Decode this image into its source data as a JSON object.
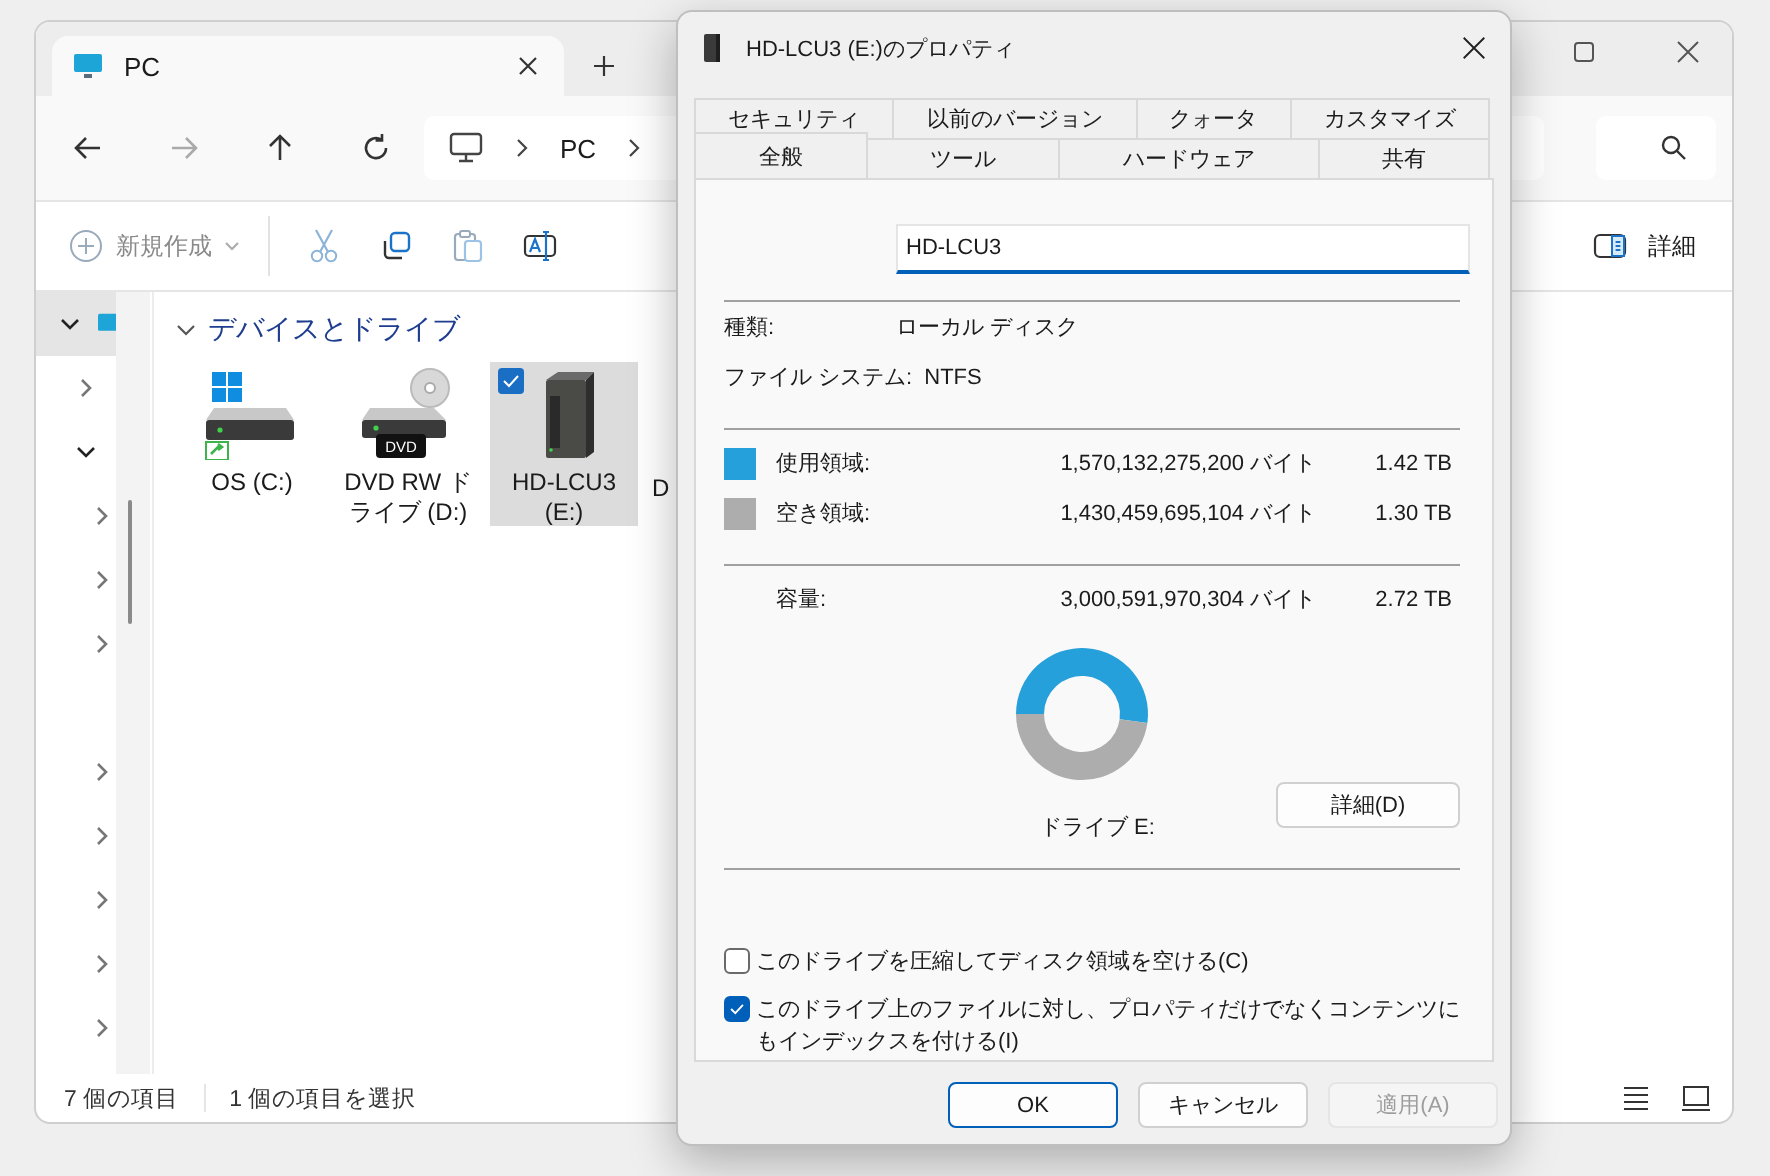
{
  "explorer": {
    "tabs": [
      {
        "title": "PC",
        "selected": true
      }
    ],
    "breadcrumb": [
      "PC"
    ],
    "new_button": "新規作成",
    "details_button": "詳細",
    "nav_tree": [
      {
        "selected": true,
        "expanded": true,
        "expandable": true,
        "children": [
          {
            "selected": false,
            "expanded": false,
            "expandable": true
          },
          {
            "selected": false,
            "expanded": true,
            "expandable": true,
            "children": [
              {
                "selected": false,
                "expanded": false,
                "expandable": true
              },
              {
                "selected": false,
                "expanded": false,
                "expandable": true
              },
              {
                "selected": false,
                "expanded": false,
                "expandable": true
              },
              {
                "selected": false
              },
              {
                "selected": false,
                "expanded": false,
                "expandable": true
              },
              {
                "selected": false,
                "expanded": false,
                "expandable": true
              },
              {
                "selected": false,
                "expanded": false,
                "expandable": true
              },
              {
                "selected": false,
                "expanded": false,
                "expandable": true
              },
              {
                "selected": false,
                "expanded": false,
                "expandable": true
              }
            ]
          }
        ]
      }
    ],
    "group": {
      "title": "デバイスとドライブ",
      "expanded": true
    },
    "drives": [
      {
        "label": "OS (C:)",
        "kind": "system",
        "selected": false
      },
      {
        "label": "DVD RW ドライブ (D:)",
        "kind": "dvd",
        "badge": "DVD",
        "selected": false
      },
      {
        "label": "HD-LCU3 (E:)",
        "kind": "external",
        "selected": true
      },
      {
        "label": "D",
        "kind": "covered",
        "selected": false
      }
    ],
    "status": {
      "count": "7 個の項目",
      "selection": "1 個の項目を選択"
    }
  },
  "dialog": {
    "title": "HD-LCU3 (E:)のプロパティ",
    "tab_rows": [
      [
        {
          "label": "セキュリティ",
          "selected": false
        },
        {
          "label": "以前のバージョン",
          "selected": false
        },
        {
          "label": "クォータ",
          "selected": false
        },
        {
          "label": "カスタマイズ",
          "selected": false
        }
      ],
      [
        {
          "label": "全般",
          "selected": true
        },
        {
          "label": "ツール",
          "selected": false
        },
        {
          "label": "ハードウェア",
          "selected": false
        },
        {
          "label": "共有",
          "selected": false
        }
      ]
    ],
    "name": "HD-LCU3",
    "info": [
      {
        "label": "種類:",
        "value": "ローカル ディスク"
      },
      {
        "label": "ファイル システム:",
        "value": "NTFS"
      }
    ],
    "usage": [
      {
        "label": "使用領域:",
        "bytes": "1,570,132,275,200 バイト",
        "size": "1.42 TB",
        "color": "#26a0da"
      },
      {
        "label": "空き領域:",
        "bytes": "1,430,459,695,104 バイト",
        "size": "1.30 TB",
        "color": "#adadad"
      }
    ],
    "capacity": {
      "label": "容量:",
      "bytes": "3,000,591,970,304 バイト",
      "size": "2.72 TB"
    },
    "chart_data": {
      "type": "donut",
      "values": [
        52.2,
        47.8
      ]
    },
    "drive_label": "ドライブ E:",
    "details_button": "詳細(D)",
    "options": [
      {
        "label": "このドライブを圧縮してディスク領域を空ける(C)",
        "checked": false
      },
      {
        "label": "このドライブ上のファイルに対し、プロパティだけでなくコンテンツにもインデックスを付ける(I)",
        "checked": true
      }
    ],
    "buttons": [
      {
        "label": "OK",
        "kind": "default",
        "disabled": false
      },
      {
        "label": "キャンセル",
        "kind": "normal",
        "disabled": false
      },
      {
        "label": "適用(A)",
        "kind": "normal",
        "disabled": true
      }
    ]
  }
}
